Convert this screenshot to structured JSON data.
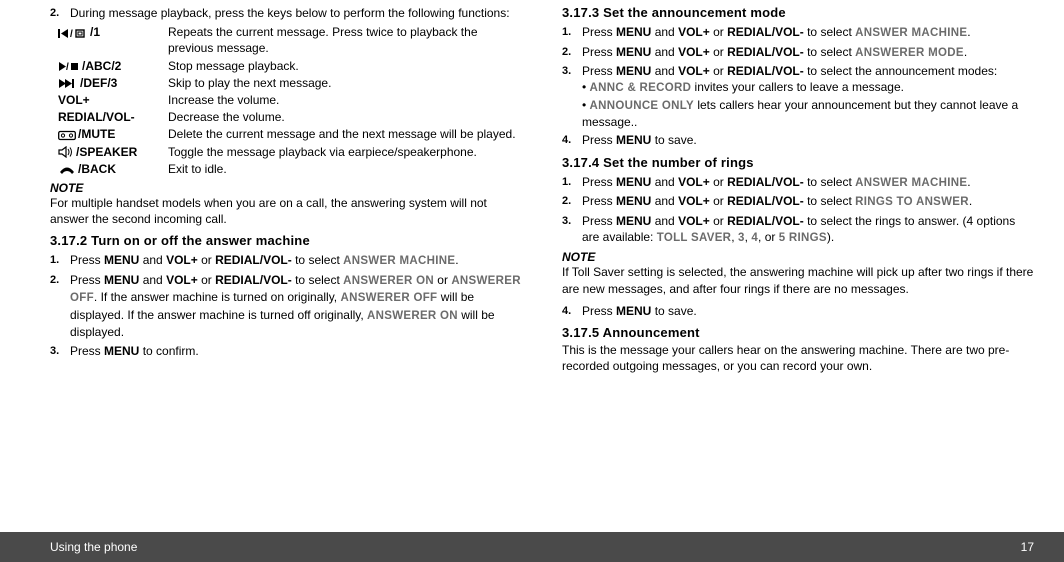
{
  "left": {
    "item2_num": "2.",
    "item2_text": "During message playback, press the keys below to perform the following functions:",
    "keys": [
      {
        "label_text": "/1",
        "desc": "Repeats the current message. Press twice to playback the previous message."
      },
      {
        "label_text": "/ABC/2",
        "desc": "Stop message playback."
      },
      {
        "label_text": "/DEF/3",
        "desc": "Skip to play the next message."
      },
      {
        "label_text": "VOL+",
        "desc": "Increase the volume."
      },
      {
        "label_text": "REDIAL/VOL-",
        "desc": "Decrease the volume."
      },
      {
        "label_text": "/MUTE",
        "desc": "Delete the current message and the next message will be played."
      },
      {
        "label_text": "/SPEAKER",
        "desc": "Toggle the message playback via earpiece/speakerphone."
      },
      {
        "label_text": "/BACK",
        "desc": "Exit to idle."
      }
    ],
    "note_hd": "NOTE",
    "note_body": "For multiple handset models when you are on a call, the answering system will not answer the second incoming call.",
    "sec3172_hd": "3.17.2    Turn on or off the answer machine",
    "s3172": {
      "n1": "1.",
      "n2": "2.",
      "n3": "3.",
      "t1a": "Press ",
      "menu": "MENU",
      "t1b": " and ",
      "volp": "VOL+",
      "t1c": " or ",
      "redial": "REDIAL/VOL-",
      "t1d": " to select ",
      "am": "ANSWER MACHINE",
      "t1e": ".",
      "t2a": "Press ",
      "t2d": " to select ",
      "aon": "ANSWERER ON",
      "t2e": " or ",
      "aoff": "ANSWERER OFF",
      "t2f": ". If the answer machine is turned on originally, ",
      "aoff2": "ANSWERER OFF",
      "t2g": " will be displayed. If the answer machine is turned off originally, ",
      "aon2": "ANSWERER ON",
      "t2h": " will be displayed.",
      "t3a": "Press ",
      "t3b": " to confirm."
    }
  },
  "right": {
    "sec3173_hd": "3.17.3    Set the announcement mode",
    "s3173": {
      "n1": "1.",
      "n2": "2.",
      "n3": "3.",
      "n4": "4.",
      "press": "Press ",
      "menu": "MENU",
      "and": " and ",
      "volp": "VOL+",
      "or": " or ",
      "redial": "REDIAL/VOL-",
      "tosel": " to select ",
      "am": "ANSWER MACHINE",
      "dot": ".",
      "amode": "ANSWERER MODE",
      "t3end": " to select the announcement modes:",
      "b1a": "• ",
      "annc": "ANNC & RECORD",
      "b1b": " invites your callers to leave a message.",
      "b2a": "• ",
      "annonly": "ANNOUNCE ONLY",
      "b2b": " lets callers hear your announcement but they cannot leave a message..",
      "t4": " to save."
    },
    "sec3174_hd": "3.17.4    Set the number of rings",
    "s3174": {
      "n1": "1.",
      "n2": "2.",
      "n3": "3.",
      "n4": "4.",
      "rings": "RINGS TO ANSWER",
      "t3a": " to select the rings to answer. (4 options are available: ",
      "ts": "TOLL SAVER",
      "c1": ", ",
      "o3": "3",
      "c2": ", ",
      "o4": "4",
      "c3": ", or ",
      "o5": "5 RINGS",
      "t3b": ").",
      "note_hd": "NOTE",
      "note_body": "If Toll Saver setting is selected, the answering machine will pick up after two rings if there are new messages, and after four rings if there are no messages.",
      "t4": " to save."
    },
    "sec3175_hd": "3.17.5    Announcement",
    "s3175_body": "This is the message your callers hear on the answering machine. There are two pre-recorded outgoing messages, or you can record your own."
  },
  "footer": {
    "left": "Using the phone",
    "right": "17"
  }
}
